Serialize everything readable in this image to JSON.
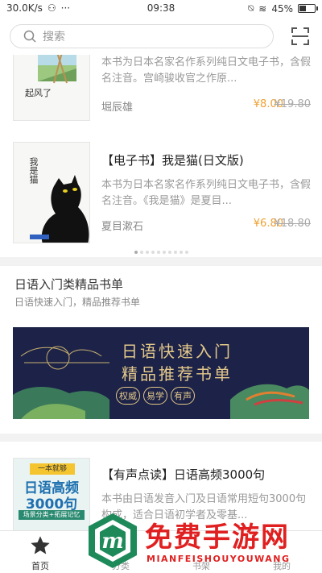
{
  "status": {
    "speed": "30.0K/s",
    "time": "09:38",
    "battery": "45%",
    "battery_level": 0.45
  },
  "search": {
    "placeholder": "搜索"
  },
  "books": [
    {
      "title": "",
      "desc": "本书为日本名家名作系列纯日文电子书，含假名注音。宫崎骏收官之作原...",
      "author": "堀辰雄",
      "price": "¥8.00",
      "orig": "¥19.80",
      "cover_title": "起风了"
    },
    {
      "title": "【电子书】我是猫(日文版)",
      "desc": "本书为日本名家名作系列纯日文电子书，含假名注音。《我是猫》是夏目...",
      "author": "夏目漱石",
      "price": "¥6.80",
      "orig": "¥18.80",
      "cover_title": "我是猫"
    }
  ],
  "carousel": {
    "count": 10,
    "active": 0
  },
  "section": {
    "title": "日语入门类精品书单",
    "subtitle": "日语快速入门，精品推荐书单",
    "banner_line1": "日语快速入门",
    "banner_line2": "精品推荐书单",
    "banner_tags": [
      "权威",
      "易学",
      "有声"
    ]
  },
  "book3": {
    "title": "【有声点读】日语高频3000句",
    "desc": "本书由日语发音入门及日语常用短句3000句构成，适合日语初学者及零基...",
    "cover_top": "一本就够",
    "cover_main1": "日语高频",
    "cover_main2": "3000句",
    "cover_band": "场景分类+拓展记忆"
  },
  "tabs": [
    {
      "label": "首页",
      "icon": "star-icon"
    },
    {
      "label": "分类",
      "icon": "grid-icon"
    },
    {
      "label": "书架",
      "icon": "shelf-icon"
    },
    {
      "label": "我的",
      "icon": "user-icon"
    }
  ],
  "watermark": {
    "text": "免费手游网",
    "sub": "MIANFEISHOUYOUWANG",
    "logo_letter": "m"
  },
  "colors": {
    "price": "#f0a030",
    "banner_bg": "#1d2348",
    "banner_text": "#e4c88a",
    "watermark": "#e02020",
    "logo_green": "#1e8a5a"
  }
}
